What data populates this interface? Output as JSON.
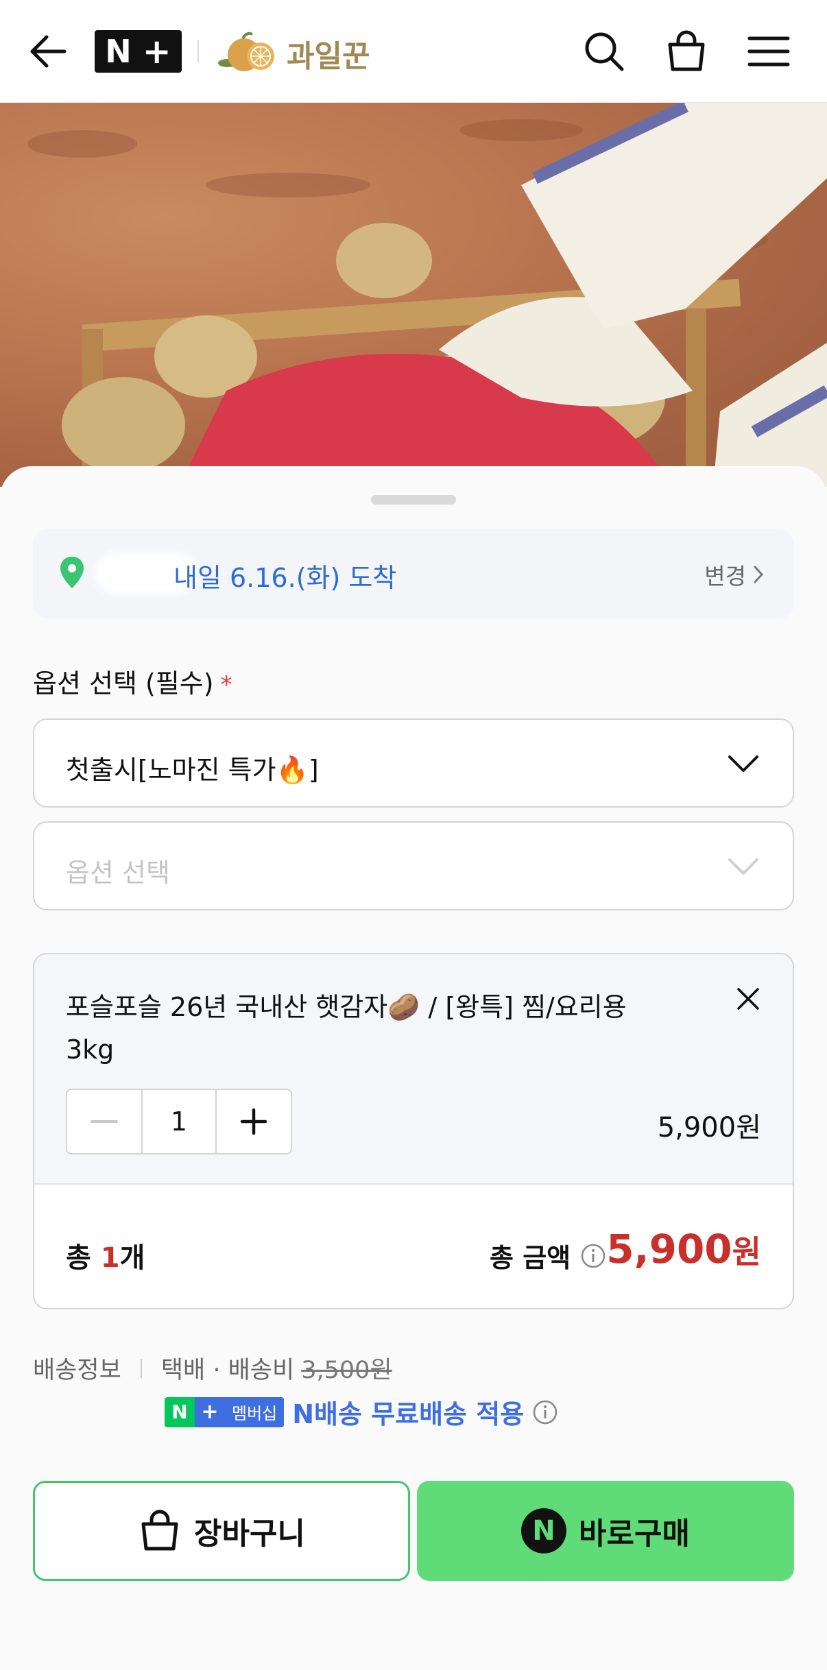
{
  "header": {
    "brand_n": "N",
    "brand_plus": "+",
    "store_name": "과일꾼"
  },
  "delivery": {
    "arrival_text": "내일 6.16.(화) 도착",
    "change_label": "변경"
  },
  "options": {
    "title": "옵션 선택 (필수)",
    "required_mark": "*",
    "selected_option": "첫출시[노마진 특가🔥]",
    "second_placeholder": "옵션 선택"
  },
  "selected_item": {
    "name": "포슬포슬 26년 국내산 햇감자🥔 / [왕특] 찜/요리용 3kg",
    "quantity": "1",
    "price": "5,900원"
  },
  "totals": {
    "count_prefix": "총 ",
    "count_num": "1",
    "count_suffix": "개",
    "amount_label": "총 금액",
    "amount_value": "5,900",
    "amount_unit": "원"
  },
  "shipping": {
    "label": "배송정보",
    "method": "택배 · 배송비",
    "original_fee": "3,500원",
    "badge_n": "N",
    "badge_plus": "+",
    "badge_text": "멤버십",
    "benefit_text": "N배송 무료배송 적용"
  },
  "actions": {
    "cart_label": "장바구니",
    "buy_label": "바로구매",
    "buy_badge": "N"
  },
  "colors": {
    "accent_green": "#5fdc78",
    "price_red": "#c9302c",
    "link_blue": "#2d6cd3"
  }
}
